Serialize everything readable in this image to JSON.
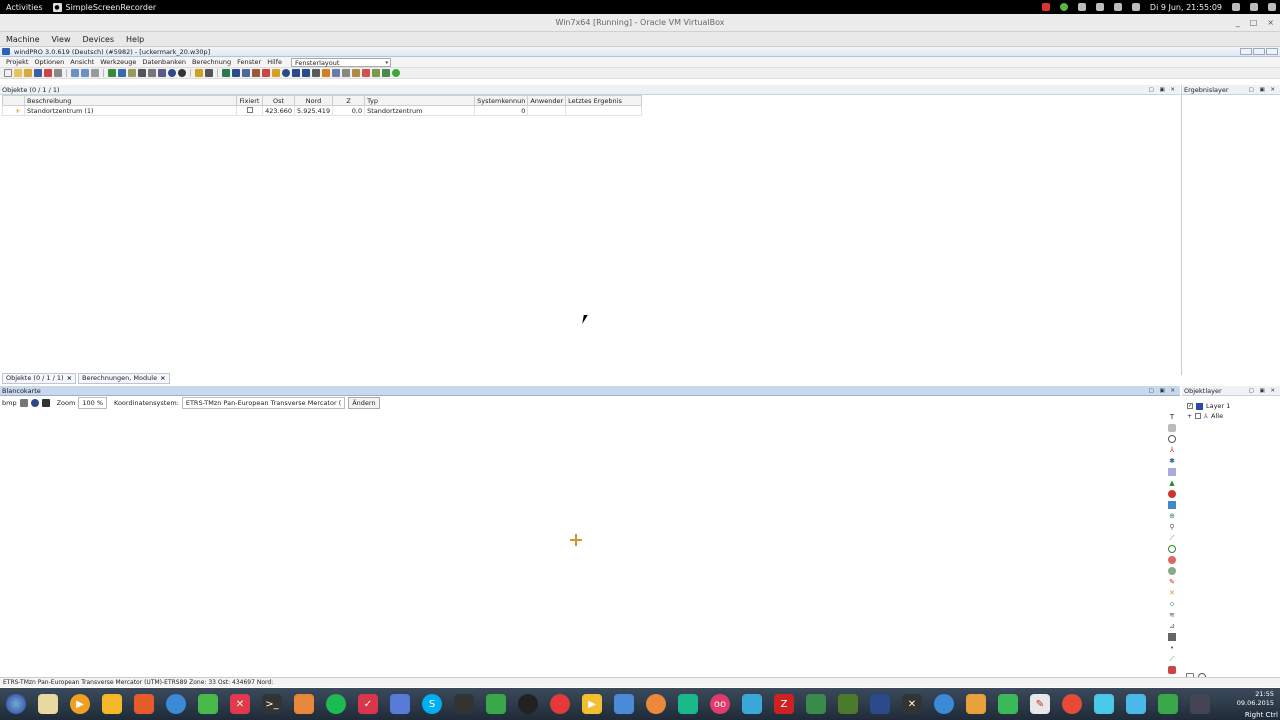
{
  "gnome": {
    "activities": "Activities",
    "app_name": "SimpleScreenRecorder",
    "datetime": "Di 9 Jun, 21:55:09"
  },
  "vbox": {
    "title": "Win7x64 [Running] - Oracle VM VirtualBox",
    "menu": [
      "Machine",
      "View",
      "Devices",
      "Help"
    ]
  },
  "windpro": {
    "title": "windPRO 3.0.619 (Deutsch) (#5982) - [uckermark_20.w30p]",
    "menu": [
      "Projekt",
      "Optionen",
      "Ansicht",
      "Werkzeuge",
      "Datenbanken",
      "Berechnung",
      "Fenster",
      "Hilfe"
    ],
    "layout_select": "Fensterlayout"
  },
  "objects_panel": {
    "title": "Objekte (0 / 1 / 1)",
    "columns": [
      "Beschreibung",
      "Fixiert",
      "Ost",
      "Nord",
      "Z",
      "Typ",
      "Systemkennun",
      "Anwender",
      "Letztes Ergebnis"
    ],
    "rows": [
      {
        "beschreibung": "Standortzentrum (1)",
        "ost": "423.660",
        "nord": "5.925.419",
        "z": "0,0",
        "typ": "Standortzentrum",
        "system": "0"
      }
    ],
    "tabs": [
      "Objekte (0 / 1 / 1)",
      "Berechnungen, Module"
    ]
  },
  "ergebnis_panel": {
    "title": "Ergebnislayer"
  },
  "map_panel": {
    "title": "Blancokarte",
    "bmp_label": "bmp",
    "zoom_label": "Zoom",
    "zoom_value": "100 %",
    "coord_label": "Koordinatensystem:",
    "coord_value": "ETRS-TMzn Pan-European Transverse Mercator (",
    "change_button": "Ändern"
  },
  "objektlayer_panel": {
    "title": "Objektlayer",
    "layers": [
      "Layer 1",
      "Alle"
    ]
  },
  "statusbar": {
    "text": "ETRS-TMzn Pan-European Transverse Mercator (UTM)-ETRS89 Zone: 33  Ost: 434697  Nord:"
  },
  "taskbar": {
    "time": "21:55",
    "date": "09.06.2015",
    "host_key": "Right Ctrl"
  },
  "colors": {
    "accent_orange": "#d9912a",
    "panel_blue": "#c9d8ec"
  }
}
